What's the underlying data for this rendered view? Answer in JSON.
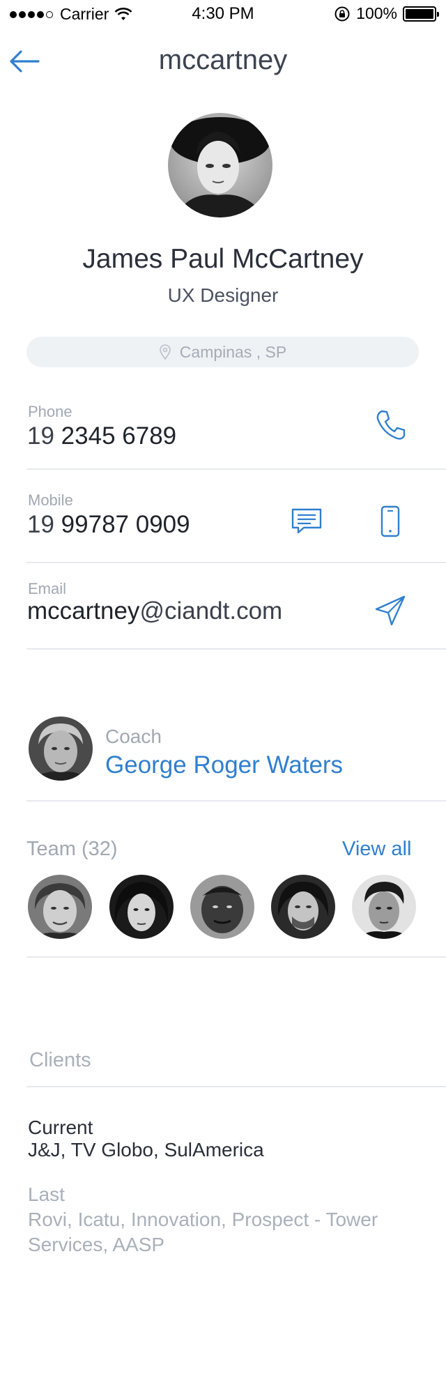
{
  "status_bar": {
    "carrier": "Carrier",
    "time": "4:30 PM",
    "battery": "100%"
  },
  "header": {
    "title": "mccartney",
    "back_icon": "arrow-left-icon"
  },
  "profile": {
    "name": "James Paul McCartney",
    "role": "UX Designer",
    "location": "Campinas , SP"
  },
  "contacts": {
    "phone": {
      "label": "Phone",
      "area": "19",
      "number": "2345 6789"
    },
    "mobile": {
      "label": "Mobile",
      "area": "19",
      "number": "99787 0909"
    },
    "email": {
      "label": "Email",
      "user": "mccartney",
      "domain": "@ciandt.com"
    }
  },
  "coach": {
    "label": "Coach",
    "name": "George Roger Waters"
  },
  "team": {
    "label": "Team (32)",
    "view_all": "View all"
  },
  "clients": {
    "title": "Clients",
    "current_label": "Current",
    "current_value": "J&J, TV Globo, SulAmerica",
    "last_label": "Last",
    "last_value": "Rovi, Icatu, Innovation, Prospect - Tower Services, AASP"
  },
  "colors": {
    "accent": "#2f7fcf",
    "muted": "#a1a8b2",
    "divider": "#e6e9ed",
    "pill": "#eff2f5"
  }
}
